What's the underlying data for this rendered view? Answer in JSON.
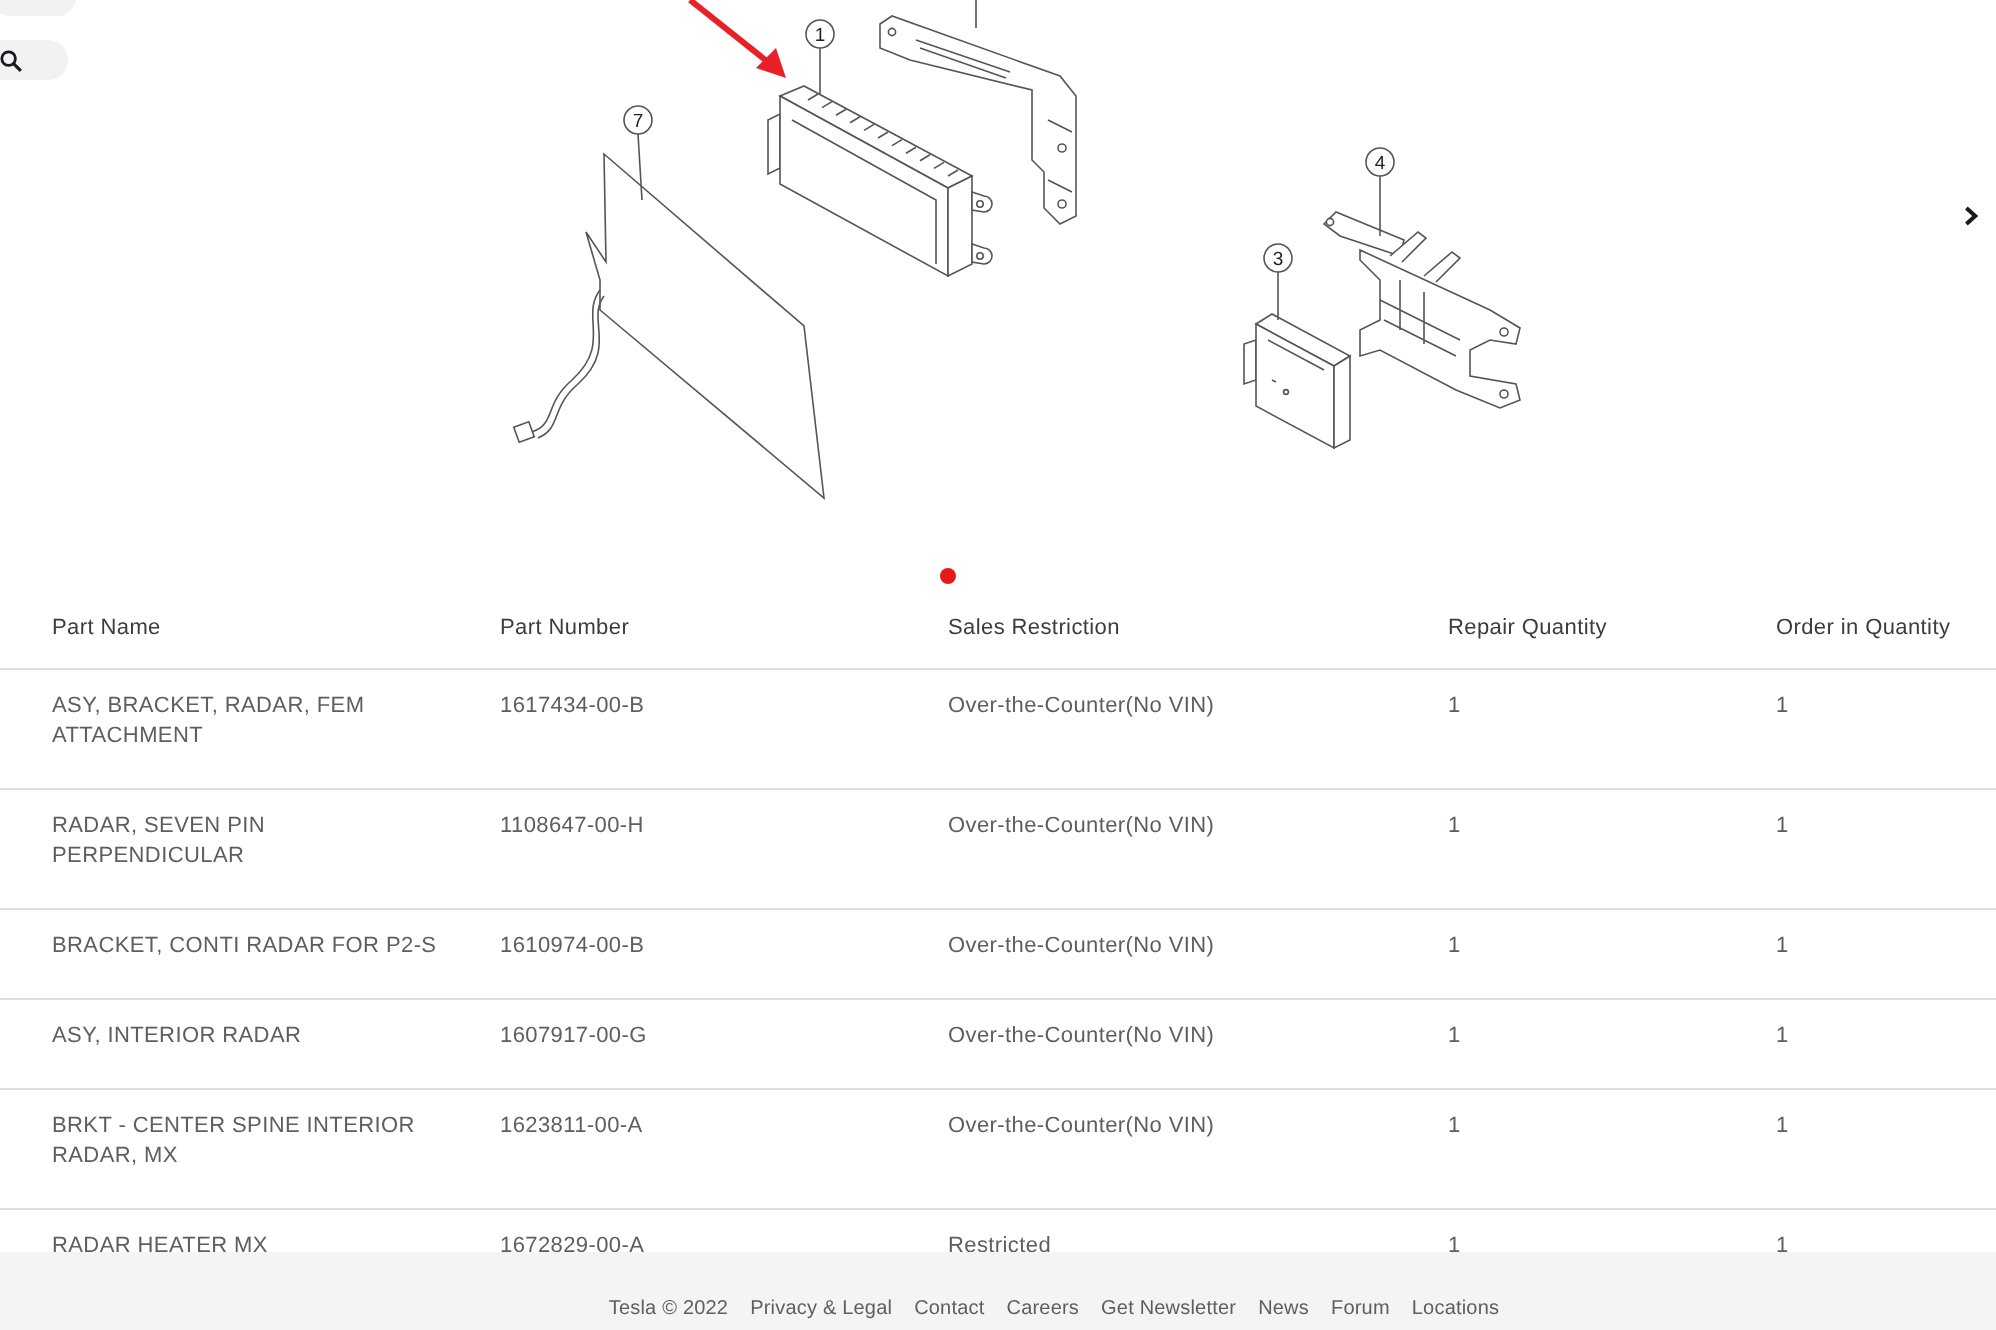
{
  "image_viewer": {
    "callouts": [
      {
        "number": "1"
      },
      {
        "number": "7"
      },
      {
        "number": "4"
      },
      {
        "number": "3"
      }
    ],
    "carousel_dots": [
      {
        "selected": true
      }
    ]
  },
  "table": {
    "columns": [
      "Part Name",
      "Part Number",
      "Sales Restriction",
      "Repair Quantity",
      "Order in Quantity"
    ],
    "rows": [
      [
        "ASY, BRACKET, RADAR, FEM ATTACHMENT",
        "1617434-00-B",
        "Over-the-Counter(No VIN)",
        "1",
        "1"
      ],
      [
        "RADAR, SEVEN PIN PERPENDICULAR",
        "1108647-00-H",
        "Over-the-Counter(No VIN)",
        "1",
        "1"
      ],
      [
        "BRACKET, CONTI RADAR FOR P2-S",
        "1610974-00-B",
        "Over-the-Counter(No VIN)",
        "1",
        "1"
      ],
      [
        "ASY, INTERIOR RADAR",
        "1607917-00-G",
        "Over-the-Counter(No VIN)",
        "1",
        "1"
      ],
      [
        "BRKT - CENTER SPINE INTERIOR RADAR, MX",
        "1623811-00-A",
        "Over-the-Counter(No VIN)",
        "1",
        "1"
      ],
      [
        "RADAR HEATER MX",
        "1672829-00-A",
        "Restricted",
        "1",
        "1"
      ]
    ]
  },
  "footer": {
    "copyright": "Tesla © 2022",
    "links": [
      "Privacy & Legal",
      "Contact",
      "Careers",
      "Get Newsletter",
      "News",
      "Forum",
      "Locations"
    ]
  }
}
